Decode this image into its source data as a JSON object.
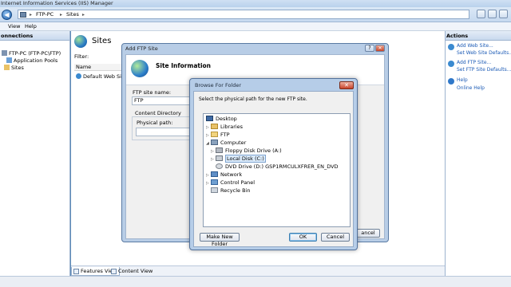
{
  "window": {
    "title": "Internet Information Services (IIS) Manager"
  },
  "address": {
    "crumbs": [
      "FTP-PC",
      "Sites"
    ]
  },
  "menu": [
    "View",
    "Help"
  ],
  "connections": {
    "header": "onnections",
    "tree": [
      {
        "label": "FTP-PC (FTP-PC\\FTP)"
      },
      {
        "label": "Application Pools"
      },
      {
        "label": "Sites"
      }
    ]
  },
  "main": {
    "title": "Sites",
    "filter_label": "Filter:",
    "column_name": "Name",
    "sites": [
      "Default Web Site"
    ]
  },
  "actions": {
    "header": "Actions",
    "items": [
      {
        "label": "Add Web Site..."
      },
      {
        "label": "Set Web Site Defaults..."
      },
      {
        "label": "Add FTP Site..."
      },
      {
        "label": "Set FTP Site Defaults..."
      },
      {
        "label": "Help"
      },
      {
        "label": "Online Help"
      }
    ]
  },
  "view_tabs": [
    "Features View",
    "Content View"
  ],
  "add_ftp_dialog": {
    "title": "Add FTP Site",
    "header": "Site Information",
    "site_name_label": "FTP site name:",
    "site_name_value": "FTP",
    "content_dir_label": "Content Directory",
    "physical_path_label": "Physical path:",
    "cancel_label": "ancel"
  },
  "browse_dialog": {
    "title": "Browse For Folder",
    "instruction": "Select the physical path for the new FTP site.",
    "tree": [
      {
        "label": "Desktop",
        "icon": "desktop-icon"
      },
      {
        "label": "Libraries",
        "icon": "folder-icon"
      },
      {
        "label": "FTP",
        "icon": "folder-icon"
      },
      {
        "label": "Computer",
        "icon": "computer-icon"
      },
      {
        "label": "Floppy Disk Drive (A:)",
        "icon": "floppy-icon"
      },
      {
        "label": "Local Disk (C:)",
        "icon": "disk-icon"
      },
      {
        "label": "DVD Drive (D:) GSP1RMCULXFRER_EN_DVD",
        "icon": "dvd-icon"
      },
      {
        "label": "Network",
        "icon": "network-icon"
      },
      {
        "label": "Control Panel",
        "icon": "control-panel-icon"
      },
      {
        "label": "Recycle Bin",
        "icon": "recycle-bin-icon"
      }
    ],
    "make_new_folder_label": "Make New Folder",
    "ok_label": "OK",
    "cancel_label": "Cancel"
  },
  "colors": {
    "accent": "#1c5bb6",
    "window_frame": "#b6cde8",
    "close": "#c8432a"
  }
}
